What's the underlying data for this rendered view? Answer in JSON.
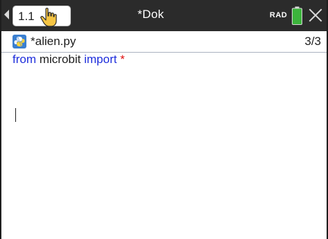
{
  "title_bar": {
    "page_tab": "1.1",
    "document_title": "*Dok",
    "angle_mode": "RAD",
    "icons": [
      "chevron-left-icon",
      "hand-pointer-icon",
      "battery-icon",
      "close-icon"
    ],
    "colors": {
      "bar": "#2b2b2b",
      "battery": "#3cb43c"
    }
  },
  "file_header": {
    "icon": "python-icon",
    "file_name": "*alien.py",
    "line_position": "3/3"
  },
  "editor": {
    "line1": {
      "keyword_from": "from",
      "module": " microbit ",
      "keyword_import": "import",
      "space": " ",
      "wildcard": "*"
    },
    "colors": {
      "keyword": "#1f2fdc",
      "wildcard": "#e01010"
    }
  }
}
